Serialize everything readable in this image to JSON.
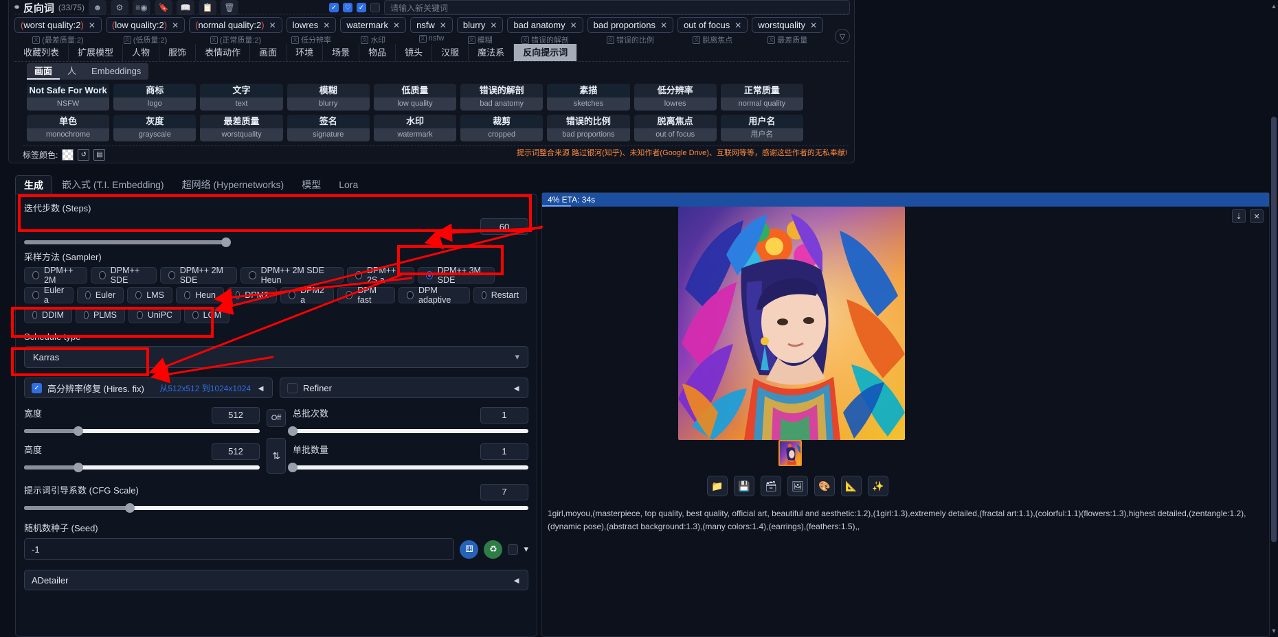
{
  "prompt_header": {
    "title": "反向词",
    "count": "(33/75)",
    "icons": [
      "mask-icon",
      "gear-icon",
      "translate-icon",
      "bookmark-icon",
      "book-icon",
      "copy-icon",
      "trash-icon"
    ],
    "checkbox_1": true,
    "checkbox_2": false,
    "checkbox_3": true,
    "checkbox_4": false,
    "search_placeholder": "请输入新关键词"
  },
  "chips": [
    {
      "label": "(worst quality:2)",
      "cn": "(最差质量:2)",
      "paren": true
    },
    {
      "label": "(low quality:2)",
      "cn": "(低质量:2)",
      "paren": true
    },
    {
      "label": "(normal quality:2)",
      "cn": "(正常质量:2)",
      "paren": true
    },
    {
      "label": "lowres",
      "cn": "低分辨率",
      "paren": false
    },
    {
      "label": "watermark",
      "cn": "水印",
      "paren": false
    },
    {
      "label": "nsfw",
      "cn": "nsfw",
      "paren": false
    },
    {
      "label": "blurry",
      "cn": "模糊",
      "paren": false
    },
    {
      "label": "bad anatomy",
      "cn": "错误的解剖",
      "paren": false
    },
    {
      "label": "bad proportions",
      "cn": "错误的比例",
      "paren": false
    },
    {
      "label": "out of focus",
      "cn": "脱离焦点",
      "paren": false
    },
    {
      "label": "worstquality",
      "cn": "最差质量",
      "paren": false
    }
  ],
  "category_tabs": [
    {
      "label": "收藏列表",
      "active": false
    },
    {
      "label": "扩展模型",
      "active": false
    },
    {
      "label": "人物",
      "active": false
    },
    {
      "label": "服饰",
      "active": false
    },
    {
      "label": "表情动作",
      "active": false
    },
    {
      "label": "画面",
      "active": false
    },
    {
      "label": "环境",
      "active": false
    },
    {
      "label": "场景",
      "active": false
    },
    {
      "label": "物品",
      "active": false
    },
    {
      "label": "镜头",
      "active": false
    },
    {
      "label": "汉服",
      "active": false
    },
    {
      "label": "魔法系",
      "active": false
    },
    {
      "label": "反向提示词",
      "active": true
    }
  ],
  "sub_tabs": [
    {
      "label": "画面",
      "active": true
    },
    {
      "label": "人",
      "active": false
    },
    {
      "label": "Embeddings",
      "active": false
    }
  ],
  "tag_cards": [
    {
      "cn": "Not Safe For Work",
      "en": "NSFW",
      "teal": true
    },
    {
      "cn": "商标",
      "en": "logo",
      "teal": true
    },
    {
      "cn": "文字",
      "en": "text",
      "teal": true
    },
    {
      "cn": "模糊",
      "en": "blurry",
      "teal": false
    },
    {
      "cn": "低质量",
      "en": "low quality",
      "teal": false
    },
    {
      "cn": "错误的解剖",
      "en": "bad anatomy",
      "teal": false
    },
    {
      "cn": "素描",
      "en": "sketches",
      "teal": true
    },
    {
      "cn": "低分辨率",
      "en": "lowres",
      "teal": false
    },
    {
      "cn": "正常质量",
      "en": "normal quality",
      "teal": false
    },
    {
      "cn": "单色",
      "en": "monochrome",
      "teal": false
    },
    {
      "cn": "灰度",
      "en": "grayscale",
      "teal": true
    },
    {
      "cn": "最差质量",
      "en": "worstquality",
      "teal": false
    },
    {
      "cn": "签名",
      "en": "signature",
      "teal": true
    },
    {
      "cn": "水印",
      "en": "watermark",
      "teal": false
    },
    {
      "cn": "裁剪",
      "en": "cropped",
      "teal": true
    },
    {
      "cn": "错误的比例",
      "en": "bad proportions",
      "teal": false
    },
    {
      "cn": "脱离焦点",
      "en": "out of focus",
      "teal": false
    },
    {
      "cn": "用户名",
      "en": "用户名",
      "teal": true
    }
  ],
  "label_color": {
    "text": "标签颜色:",
    "swatches": [
      "checker-swatch",
      "reset-icon",
      "palette-icon"
    ]
  },
  "tip_note": "提示词整合来源 路过银河(知乎)、未知作者(Google Drive)、互联网等等，感谢这些作者的无私奉献!",
  "gen_tabs": [
    {
      "label": "生成",
      "active": true
    },
    {
      "label": "嵌入式 (T.I. Embedding)",
      "active": false
    },
    {
      "label": "超网络 (Hypernetworks)",
      "active": false
    },
    {
      "label": "模型",
      "active": false
    },
    {
      "label": "Lora",
      "active": false
    }
  ],
  "steps": {
    "label": "迭代步数 (Steps)",
    "value": "60",
    "fill_percent": 40
  },
  "sampler": {
    "label": "采样方法 (Sampler)",
    "selected": "DPM++ 3M SDE",
    "options": [
      "DPM++ 2M",
      "DPM++ SDE",
      "DPM++ 2M SDE",
      "DPM++ 2M SDE Heun",
      "DPM++ 2S a",
      "DPM++ 3M SDE",
      "Euler a",
      "Euler",
      "LMS",
      "Heun",
      "DPM2",
      "DPM2 a",
      "DPM fast",
      "DPM adaptive",
      "Restart",
      "DDIM",
      "PLMS",
      "UniPC",
      "LCM"
    ]
  },
  "schedule": {
    "label": "Schedule type",
    "value": "Karras"
  },
  "hires": {
    "label": "高分辨率修复 (Hires. fix)",
    "checked": true,
    "resolution_text": "从512x512 到1024x1024",
    "collapse_icon": "triangle-left-icon"
  },
  "refiner": {
    "label": "Refiner",
    "checked": false,
    "collapse_icon": "triangle-left-icon"
  },
  "width": {
    "label": "宽度",
    "value": "512",
    "fill_percent": 23
  },
  "height": {
    "label": "高度",
    "value": "512",
    "fill_percent": 23
  },
  "batch_count": {
    "label": "总批次数",
    "value": "1",
    "fill_percent": 0
  },
  "batch_size": {
    "label": "单批数量",
    "value": "1",
    "fill_percent": 0
  },
  "cfg": {
    "label": "提示词引导系数 (CFG Scale)",
    "value": "7",
    "fill_percent": 21
  },
  "seed": {
    "label": "随机数种子 (Seed)",
    "value": "-1"
  },
  "off_button": "Off",
  "swap_button": "⇅",
  "adetailer": {
    "label": "ADetailer",
    "collapse_icon": "triangle-left-icon"
  },
  "right_panel": {
    "eta": "4% ETA: 34s",
    "progress_percent": 4,
    "image_tools": [
      "download-icon",
      "close-icon"
    ],
    "gallery_buttons": [
      "folder-icon",
      "save-icon",
      "zip-icon",
      "image-to-image-icon",
      "inpaint-icon",
      "extras-icon",
      "sparkle-icon"
    ],
    "output_prompt": "1girl,moyou,(masterpiece, top quality, best quality, official art, beautiful and aesthetic:1.2),(1girl:1.3),extremely detailed,(fractal art:1.1),(colorful:1.1)(flowers:1.3),highest detailed,(zentangle:1.2),(dynamic pose),(abstract background:1.3),(many colors:1.4),(earrings),(feathers:1.5),,"
  }
}
